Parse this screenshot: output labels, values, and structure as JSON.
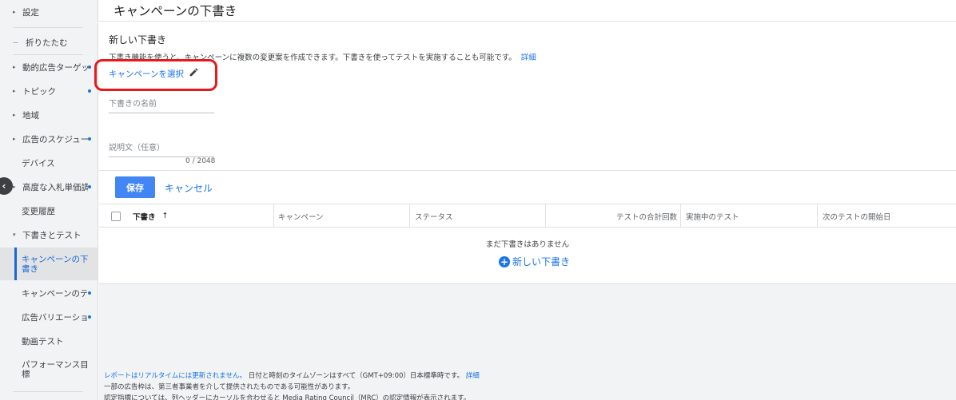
{
  "sidebar": {
    "items": [
      {
        "label": "設定",
        "caret": "▸",
        "dot": false
      },
      {
        "label": "折りたたむ",
        "caret": "—",
        "dot": false
      },
      {
        "label": "動的広告ターゲッ",
        "caret": "▸",
        "dot": true
      },
      {
        "label": "トピック",
        "caret": "▸",
        "dot": true
      },
      {
        "label": "地域",
        "caret": "▸",
        "dot": false
      },
      {
        "label": "広告のスケジュー",
        "caret": "▸",
        "dot": true
      },
      {
        "label": "デバイス",
        "caret": "",
        "dot": false
      },
      {
        "label": "高度な入札単価調",
        "caret": "▸",
        "dot": true
      },
      {
        "label": "変更履歴",
        "caret": "",
        "dot": false
      },
      {
        "label": "下書きとテスト",
        "caret": "▾",
        "dot": false
      },
      {
        "label": "キャンペーンの下書き",
        "caret": "",
        "dot": false
      },
      {
        "label": "キャンペーンのテ",
        "caret": "",
        "dot": true
      },
      {
        "label": "広告バリエーショ",
        "caret": "",
        "dot": true
      },
      {
        "label": "動画テスト",
        "caret": "",
        "dot": false
      },
      {
        "label": "パフォーマンス目標",
        "caret": "",
        "dot": false
      }
    ],
    "collapse_icon": "chevron-left-icon"
  },
  "page": {
    "title": "キャンペーンの下書き"
  },
  "form": {
    "heading": "新しい下書き",
    "description": "下書き機能を使うと、キャンペーンに複数の変更案を作成できます。下書きを使ってテストを実施することも可能です。",
    "details_link": "詳細",
    "select_campaign": "キャンペーンを選択",
    "name_placeholder": "下書きの名前",
    "description_placeholder": "説明文（任意）",
    "counter": "0 / 2048",
    "save": "保存",
    "cancel": "キャンセル",
    "highlight_color": "#e8191a"
  },
  "table": {
    "columns": [
      "下書き",
      "キャンペーン",
      "ステータス",
      "テストの合計回数",
      "実施中のテスト",
      "次のテストの開始日"
    ],
    "sort_indicator": "↑",
    "empty_message": "まだ下書きはありません",
    "new_draft": "新しい下書き"
  },
  "footer": {
    "line1_link": "レポートはリアルタイムには更新されません。",
    "line1_text": "日付と時刻のタイムゾーンはすべて（GMT+09:00）日本標準時です。",
    "line1_details": "詳細",
    "line2": "一部の広告枠は、第三者事業者を介して提供されたものである可能性があります。",
    "line3": "認定指標については、列ヘッダーにカーソルを合わせると Media Rating Council（MRC）の認定情報が表示されます。"
  },
  "colors": {
    "accent": "#1a73e8",
    "save_button": "#4285f4"
  }
}
